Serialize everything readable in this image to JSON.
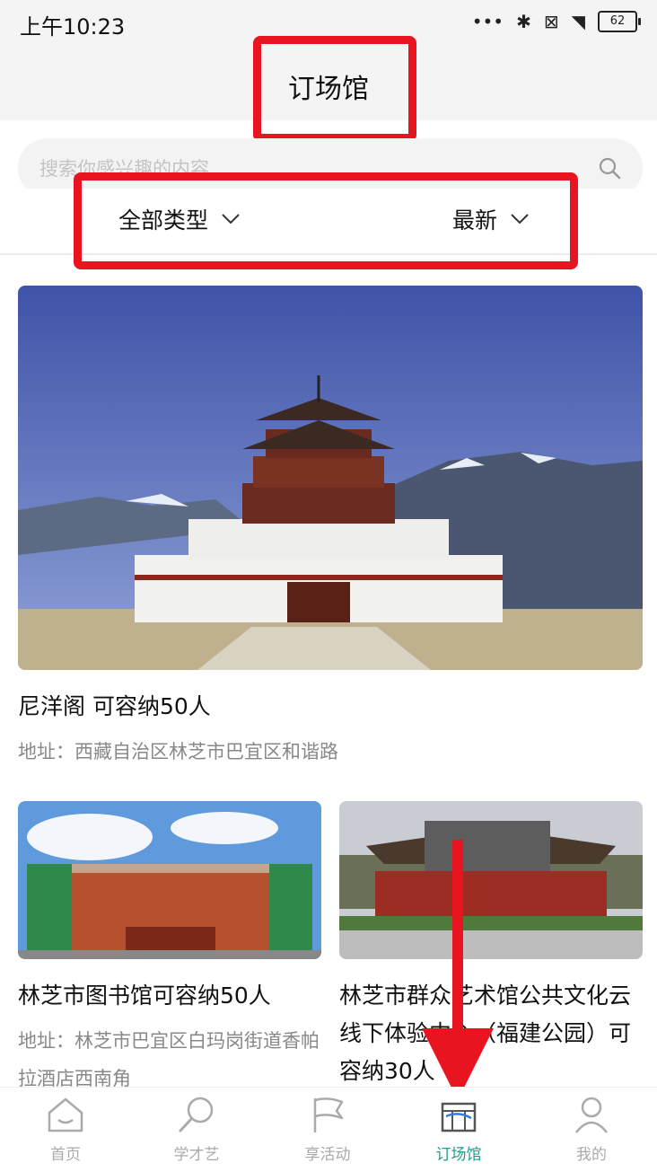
{
  "status_bar": {
    "time": "上午10:23",
    "battery": "62"
  },
  "header": {
    "title": "订场馆"
  },
  "search": {
    "placeholder": "搜索你感兴趣的内容"
  },
  "filters": {
    "type_label": "全部类型",
    "sort_label": "最新"
  },
  "venues": [
    {
      "title": "尼洋阁 可容纳50人",
      "address": "地址：西藏自治区林芝市巴宜区和谐路"
    },
    {
      "title": "林芝市图书馆可容纳50人",
      "address": "地址：林芝市巴宜区白玛岗街道香帕拉酒店西南角"
    },
    {
      "title": "林芝市群众艺术馆公共文化云线下体验中心（福建公园）可容纳30人",
      "address": ""
    }
  ],
  "tabbar": {
    "items": [
      {
        "label": "首页",
        "icon": "home-icon"
      },
      {
        "label": "学才艺",
        "icon": "magnifier-icon"
      },
      {
        "label": "享活动",
        "icon": "flag-icon"
      },
      {
        "label": "订场馆",
        "icon": "venue-icon",
        "active": true
      },
      {
        "label": "我的",
        "icon": "person-icon"
      }
    ]
  },
  "colors": {
    "accent": "#1a9e8e",
    "highlight": "#e8141f"
  }
}
